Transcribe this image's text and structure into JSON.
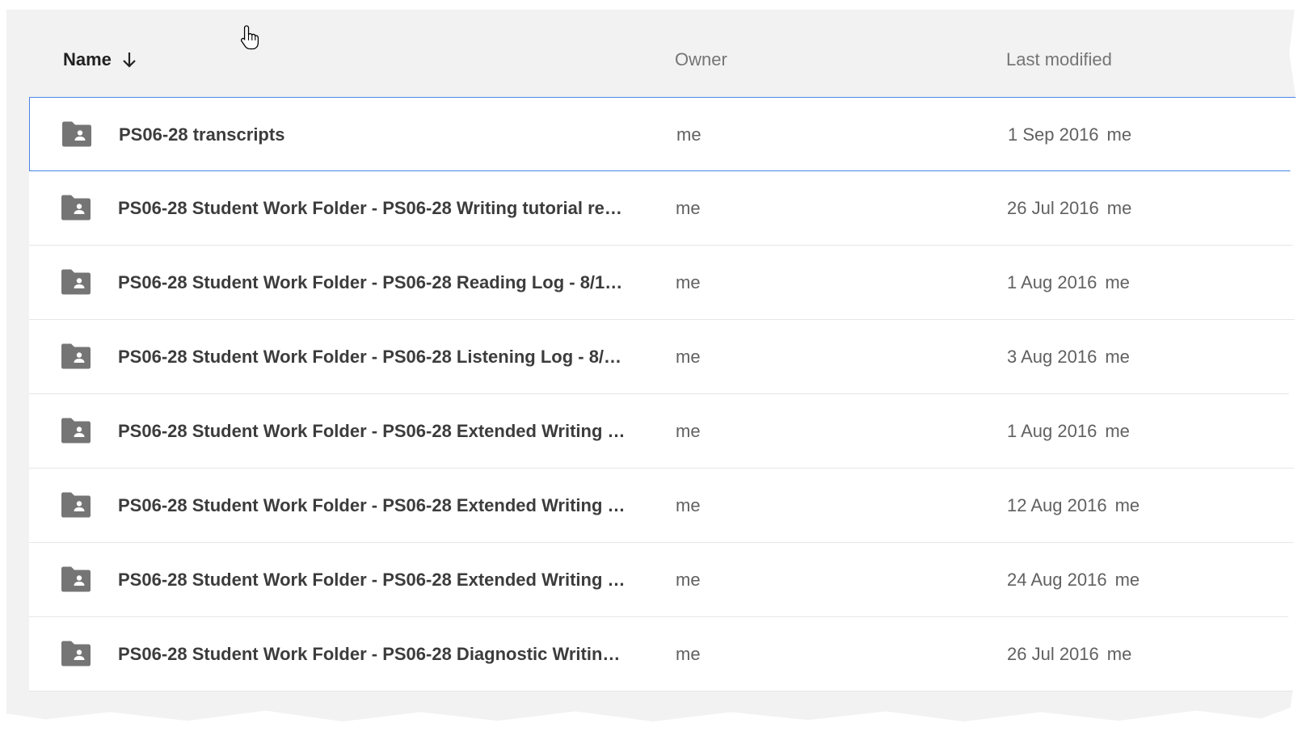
{
  "header": {
    "name_label": "Name",
    "owner_label": "Owner",
    "modified_label": "Last modified"
  },
  "colors": {
    "selected_border": "#4a86e8",
    "folder_icon": "#757575",
    "header_bg": "#f2f2f2"
  },
  "rows": [
    {
      "name": "PS06-28 transcripts",
      "owner": "me",
      "date": "1 Sep 2016",
      "modified_by": "me",
      "icon": "shared-folder-icon"
    },
    {
      "name": "PS06-28 Student Work Folder - PS06-28 Writing tutorial re…",
      "owner": "me",
      "date": "26 Jul 2016",
      "modified_by": "me",
      "icon": "shared-folder-icon"
    },
    {
      "name": "PS06-28 Student Work Folder - PS06-28 Reading Log - 8/1…",
      "owner": "me",
      "date": "1 Aug 2016",
      "modified_by": "me",
      "icon": "shared-folder-icon"
    },
    {
      "name": "PS06-28 Student Work Folder - PS06-28 Listening Log - 8/…",
      "owner": "me",
      "date": "3 Aug 2016",
      "modified_by": "me",
      "icon": "shared-folder-icon"
    },
    {
      "name": "PS06-28 Student Work Folder - PS06-28 Extended Writing …",
      "owner": "me",
      "date": "1 Aug 2016",
      "modified_by": "me",
      "icon": "shared-folder-icon"
    },
    {
      "name": "PS06-28 Student Work Folder - PS06-28 Extended Writing …",
      "owner": "me",
      "date": "12 Aug 2016",
      "modified_by": "me",
      "icon": "shared-folder-icon"
    },
    {
      "name": "PS06-28 Student Work Folder - PS06-28 Extended Writing …",
      "owner": "me",
      "date": "24 Aug 2016",
      "modified_by": "me",
      "icon": "shared-folder-icon"
    },
    {
      "name": "PS06-28 Student Work Folder - PS06-28 Diagnostic Writin…",
      "owner": "me",
      "date": "26 Jul 2016",
      "modified_by": "me",
      "icon": "shared-folder-icon"
    }
  ]
}
